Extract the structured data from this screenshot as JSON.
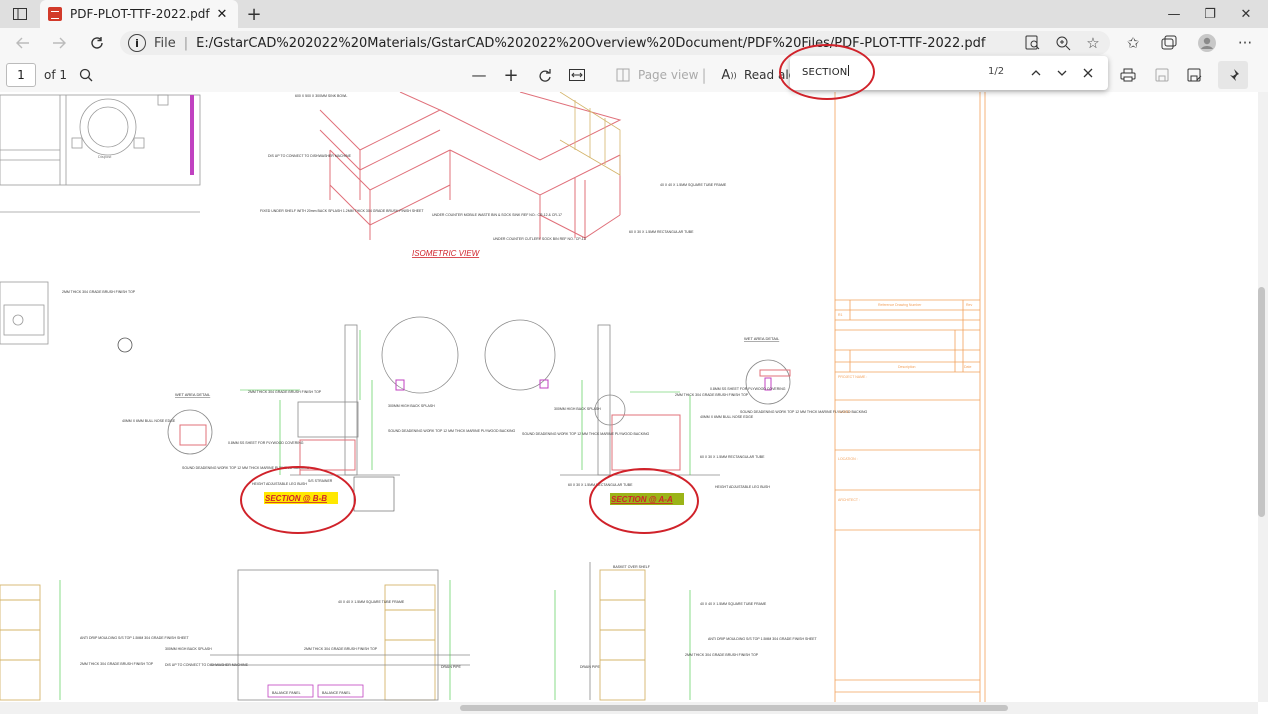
{
  "tab": {
    "title": "PDF-PLOT-TTF-2022.pdf",
    "close": "✕",
    "new": "+"
  },
  "window": {
    "minimize": "—",
    "maximize": "❐",
    "close": "✕"
  },
  "address": {
    "scheme_label": "File",
    "url": "E:/GstarCAD%202022%20Materials/GstarCAD%202022%20Overview%20Document/PDF%20Files/PDF-PLOT-TTF-2022.pdf"
  },
  "pdf_toolbar": {
    "page_number": "1",
    "page_total": "of 1",
    "page_view_label": "Page view",
    "read_aloud_label": "Read aloud"
  },
  "find": {
    "query": "SECTION",
    "count": "1/2"
  },
  "drawing": {
    "isometric_label": "ISOMETRIC VIEW",
    "section_bb": "SECTION @ B-B",
    "section_aa": "SECTION @ A-A",
    "wet_area_detail_left": "WET AREA DETAIL",
    "wet_area_detail_right": "WET AREA DETAIL",
    "dishwasher_label": "Dispost",
    "notes": {
      "sink_bowl": "600 X 500 X 300MM SINK BOWL",
      "dishwasher": "DIS UP TO CONNECT TO DISHWASHER MACHINE",
      "fixed_shelf": "FIXED UNDER SHELF WITH 20mm BACK SPLASH 1.2MM THICK 304 GRADE BRUSH FINISH SHEET",
      "frame1": "40 X 40 X 1.5MM SQUARE TUBE FRAME",
      "wb_sink": "UNDER COUNTER MOBILE WASTE BIN & SOCK SINK REF NO.: CR-12 & CR-17",
      "cutlery": "UNDER COUNTER CUTLERY SOCK BIN REF NO.: CP-13",
      "rect_tube": "60 X 30 X 1.5MM RECTANGULAR TUBE",
      "brush_top": "2MM THICK 304 GRADE BRUSH FINISH TOP",
      "bull_nose": "40MM X 6MM BULL NOSE EDGE",
      "back_splash": "300MM HIGH BACK SPLASH",
      "sound_deadening": "SOUND DEADENING WORK TOP 12 MM THICK MARINE PLYWOOD BACKING",
      "ss_steel": "0.8MM SS SHEET FOR PLYWOOD COVERING",
      "leg_bush": "HEIGHT ADJUSTABLE LEG BUSH",
      "ss_strainer": "S/S STRAINER",
      "basket_shelf": "BASKET OVER SHELF",
      "drain_pipe": "DRAIN PIPE",
      "anti_drip": "ANTI DRIP MOULDING S/S TOP 1.5MM 304 GRADE FINISH SHEET",
      "balance_panel": "BALANCE PANEL"
    },
    "titleblock": {
      "col_ref": "Reference Drawing Number",
      "rev": "Rev",
      "rev_no": "R1",
      "description": "Description",
      "date": "Date",
      "project_name": "PROJECT NAME :",
      "client": "CLIENT :",
      "location": "LOCATION :",
      "architect": "ARCHITECT :"
    }
  },
  "colors": {
    "annotation": "#d0222a",
    "cad_pink": "#e0707a",
    "cad_green": "#3cc43c",
    "cad_orange": "#f2a05a",
    "cad_magenta": "#c042c0"
  }
}
